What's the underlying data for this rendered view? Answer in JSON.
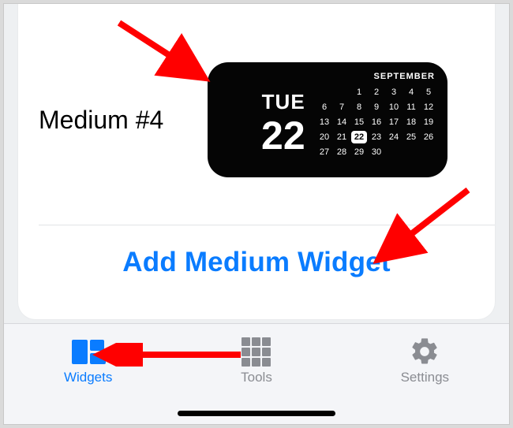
{
  "option": {
    "label": "Medium #4",
    "widget": {
      "day_abbr": "TUE",
      "date_number": "22",
      "month": "SEPTEMBER",
      "days": [
        "",
        "",
        "1",
        "2",
        "3",
        "4",
        "5",
        "6",
        "7",
        "8",
        "9",
        "10",
        "11",
        "12",
        "13",
        "14",
        "15",
        "16",
        "17",
        "18",
        "19",
        "20",
        "21",
        "22",
        "23",
        "24",
        "25",
        "26",
        "27",
        "28",
        "29",
        "30",
        "",
        "",
        ""
      ],
      "today": "22"
    }
  },
  "add_button": "Add Medium Widget",
  "tabs": {
    "widgets": "Widgets",
    "tools": "Tools",
    "settings": "Settings"
  },
  "colors": {
    "accent": "#0a7cff",
    "arrow": "#ff0000"
  }
}
